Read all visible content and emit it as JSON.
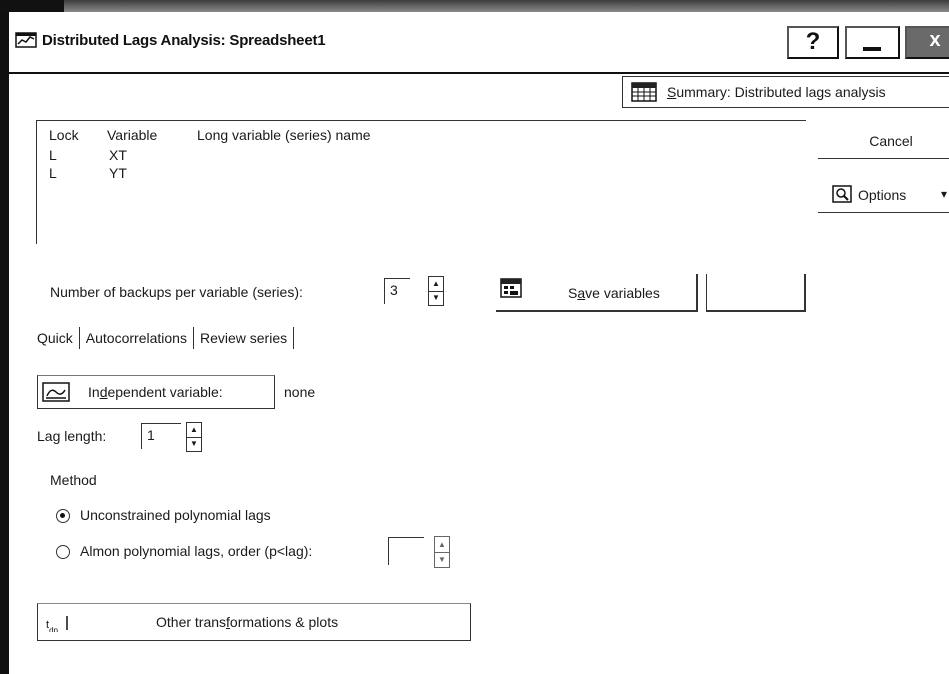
{
  "window": {
    "title": "Distributed Lags Analysis: Spreadsheet1",
    "help_glyph": "?",
    "close_glyph": "x"
  },
  "summary_button": {
    "label_underlined": "S",
    "label_rest": "ummary: Distributed lags analysis"
  },
  "variables_list": {
    "headers": [
      "Lock",
      "Variable",
      "Long variable (series) name"
    ],
    "rows": [
      {
        "lock": "L",
        "variable": "XT",
        "long_name": ""
      },
      {
        "lock": "L",
        "variable": "YT",
        "long_name": ""
      }
    ]
  },
  "cancel_button": {
    "label": "Cancel"
  },
  "options_button": {
    "label": "Options",
    "caret": "▾"
  },
  "backups": {
    "label": "Number of backups per variable (series):",
    "value": "3"
  },
  "save_variables_button": {
    "label_pre": "S",
    "label_underlined": "a",
    "label_post": "ve variables"
  },
  "tabs": [
    "Quick",
    "Autocorrelations",
    "Review series"
  ],
  "independent_variable": {
    "label_pre": "In",
    "label_underlined": "d",
    "label_post": "ependent variable:",
    "value": "none"
  },
  "lag_length": {
    "label": "Lag length:",
    "value": "1"
  },
  "method": {
    "label": "Method",
    "options": [
      {
        "label": "Unconstrained polynomial lags",
        "checked": true
      },
      {
        "label": "Almon polynomial lags, order (p<lag):",
        "checked": false
      }
    ],
    "almon_order_value": ""
  },
  "other_transformations_button": {
    "label_pre": "Other trans",
    "label_underlined": "f",
    "label_post": "ormations & plots"
  },
  "colors": {
    "background": "#ffffff",
    "text": "#1a1a1a",
    "border": "#333333"
  }
}
